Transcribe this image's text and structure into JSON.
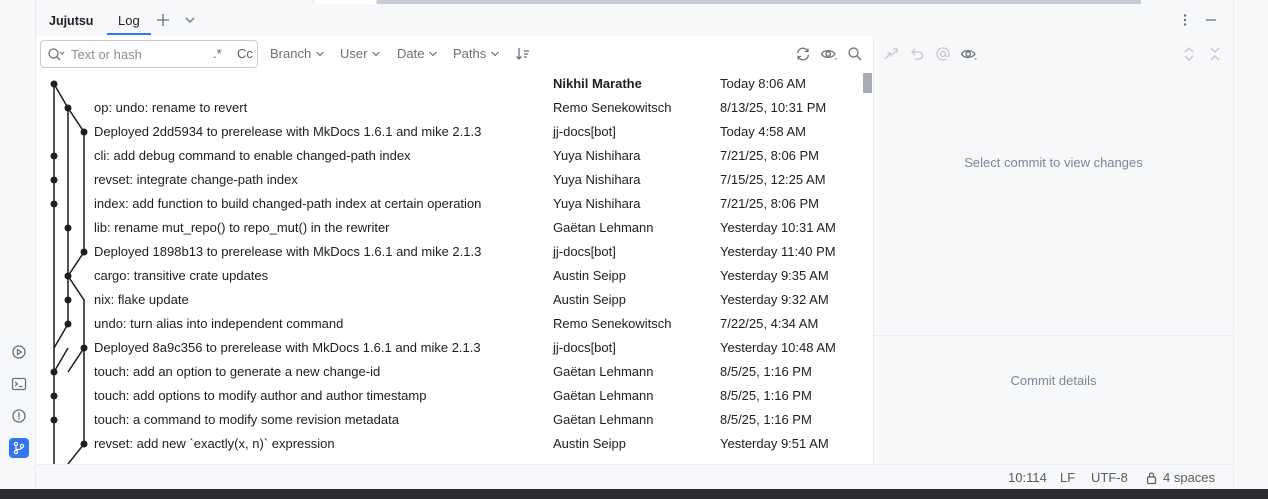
{
  "toolwindow": {
    "title": "Jujutsu",
    "tab_label": "Log"
  },
  "filter": {
    "search_placeholder": "Text or hash",
    "regex_label": ".*",
    "case_label": "Cc",
    "branch_label": "Branch",
    "user_label": "User",
    "date_label": "Date",
    "paths_label": "Paths"
  },
  "commits": [
    {
      "message": "",
      "author": "Nikhil Marathe",
      "date": "Today 8:06 AM"
    },
    {
      "message": "op: undo: rename to revert",
      "author": "Remo Senekowitsch",
      "date": "8/13/25, 10:31 PM"
    },
    {
      "message": "Deployed 2dd5934 to prerelease with MkDocs 1.6.1 and mike 2.1.3",
      "author": "jj-docs[bot]",
      "date": "Today 4:58 AM"
    },
    {
      "message": "cli: add debug command to enable changed-path index",
      "author": "Yuya Nishihara",
      "date": "7/21/25, 8:06 PM"
    },
    {
      "message": "revset: integrate change-path index",
      "author": "Yuya Nishihara",
      "date": "7/15/25, 12:25 AM"
    },
    {
      "message": "index: add function to build changed-path index at certain operation",
      "author": "Yuya Nishihara",
      "date": "7/21/25, 8:06 PM"
    },
    {
      "message": "lib: rename mut_repo() to repo_mut() in the rewriter",
      "author": "Gaëtan Lehmann",
      "date": "Yesterday 10:31 AM"
    },
    {
      "message": "Deployed 1898b13 to prerelease with MkDocs 1.6.1 and mike 2.1.3",
      "author": "jj-docs[bot]",
      "date": "Yesterday 11:40 PM"
    },
    {
      "message": "cargo: transitive crate updates",
      "author": "Austin Seipp",
      "date": "Yesterday 9:35 AM"
    },
    {
      "message": "nix: flake update",
      "author": "Austin Seipp",
      "date": "Yesterday 9:32 AM"
    },
    {
      "message": "undo: turn alias into independent command",
      "author": "Remo Senekowitsch",
      "date": "7/22/25, 4:34 AM"
    },
    {
      "message": "Deployed 8a9c356 to prerelease with MkDocs 1.6.1 and mike 2.1.3",
      "author": "jj-docs[bot]",
      "date": "Yesterday 10:48 AM"
    },
    {
      "message": "touch: add an option to generate a new change-id",
      "author": "Gaëtan Lehmann",
      "date": "8/5/25, 1:16 PM"
    },
    {
      "message": "touch: add options to modify author and author timestamp",
      "author": "Gaëtan Lehmann",
      "date": "8/5/25, 1:16 PM"
    },
    {
      "message": "touch: a command to modify some revision metadata",
      "author": "Gaëtan Lehmann",
      "date": "8/5/25, 1:16 PM"
    },
    {
      "message": "revset: add new `exactly(x, n)` expression",
      "author": "Austin Seipp",
      "date": "Yesterday 9:51 AM"
    }
  ],
  "details": {
    "changes_empty": "Select commit to view changes",
    "details_empty": "Commit details"
  },
  "status": {
    "position": "10:114",
    "line_sep": "LF",
    "encoding": "UTF-8",
    "indent": "4 spaces"
  },
  "colors": {
    "accent": "#3574f0",
    "graph": "#1e1f22"
  }
}
